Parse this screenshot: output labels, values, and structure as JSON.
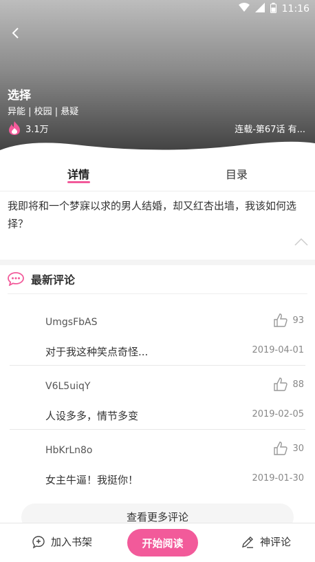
{
  "status_bar": {
    "time": "11:16"
  },
  "book": {
    "title": "选择",
    "tags": "异能 | 校园 | 悬疑",
    "heat": "3.1万",
    "serial_status": "连载-第67话 有..."
  },
  "tabs": [
    {
      "label": "详情",
      "active": true
    },
    {
      "label": "目录",
      "active": false
    }
  ],
  "synopsis": "我即将和一个梦寐以求的男人结婚，却又红杏出墙，我该如何选择？",
  "comments_section": {
    "title": "最新评论",
    "comments": [
      {
        "user": "UmgsFbAS",
        "likes": "93",
        "text": "对于我这种笑点奇怪...",
        "date": "2019-04-01"
      },
      {
        "user": "V6L5uiqY",
        "likes": "88",
        "text": "人设多多，情节多变",
        "date": "2019-02-05"
      },
      {
        "user": "HbKrLn8o",
        "likes": "30",
        "text": "女主牛逼！我挺你！",
        "date": "2019-01-30"
      }
    ],
    "more_label": "查看更多评论"
  },
  "bottom_bar": {
    "add_shelf": "加入书架",
    "start_read": "开始阅读",
    "review": "神评论"
  },
  "colors": {
    "accent": "#f25a9a"
  }
}
